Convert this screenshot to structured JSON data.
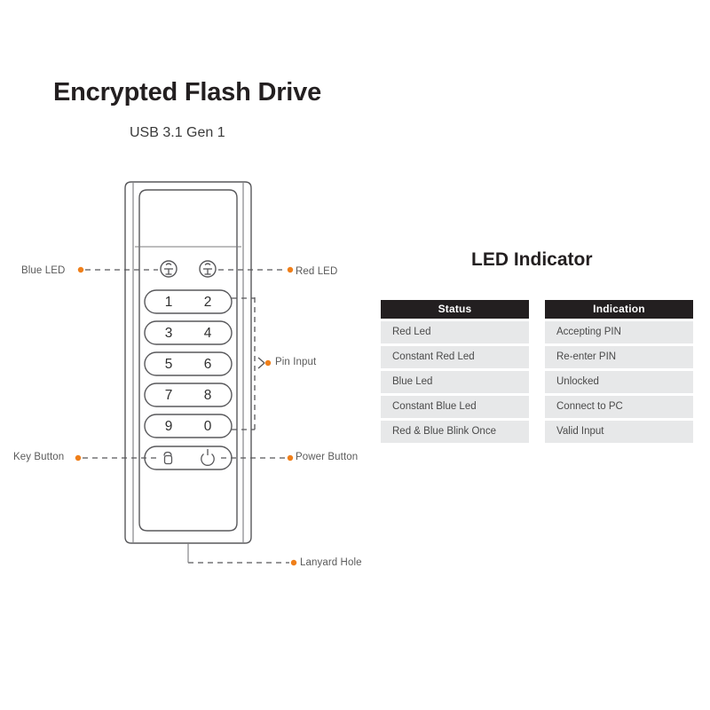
{
  "header": {
    "title": "Encrypted Flash Drive",
    "subtitle": "USB 3.1 Gen 1"
  },
  "device": {
    "keypad": {
      "rows": [
        {
          "left": "1",
          "right": "2"
        },
        {
          "left": "3",
          "right": "4"
        },
        {
          "left": "5",
          "right": "6"
        },
        {
          "left": "7",
          "right": "8"
        },
        {
          "left": "9",
          "right": "0"
        }
      ]
    },
    "leds": [
      {
        "name": "blue-led-icon"
      },
      {
        "name": "red-led-icon"
      }
    ],
    "action_buttons": [
      {
        "name": "key-button",
        "icon": "padlock-icon"
      },
      {
        "name": "power-button",
        "icon": "power-icon"
      }
    ]
  },
  "annotations": {
    "blue_led": "Blue LED",
    "red_led": "Red LED",
    "pin_input": "Pin Input",
    "key_button": "Key Button",
    "power_button": "Power Button",
    "lanyard_hole": "Lanyard Hole"
  },
  "led_panel": {
    "title": "LED Indicator",
    "columns": [
      "Status",
      "Indication"
    ],
    "rows": [
      {
        "status": "Red Led",
        "indication": "Accepting PIN"
      },
      {
        "status": "Constant Red Led",
        "indication": "Re-enter PIN"
      },
      {
        "status": "Blue Led",
        "indication": "Unlocked"
      },
      {
        "status": "Constant Blue Led",
        "indication": "Connect to PC"
      },
      {
        "status": "Red & Blue Blink Once",
        "indication": "Valid Input"
      }
    ]
  },
  "colors": {
    "accent_dot": "#ef7f1a",
    "header_bg": "#231f20",
    "row_bg": "#e7e8e9",
    "outline": "#58585b",
    "label_text": "#5a5a5a"
  }
}
